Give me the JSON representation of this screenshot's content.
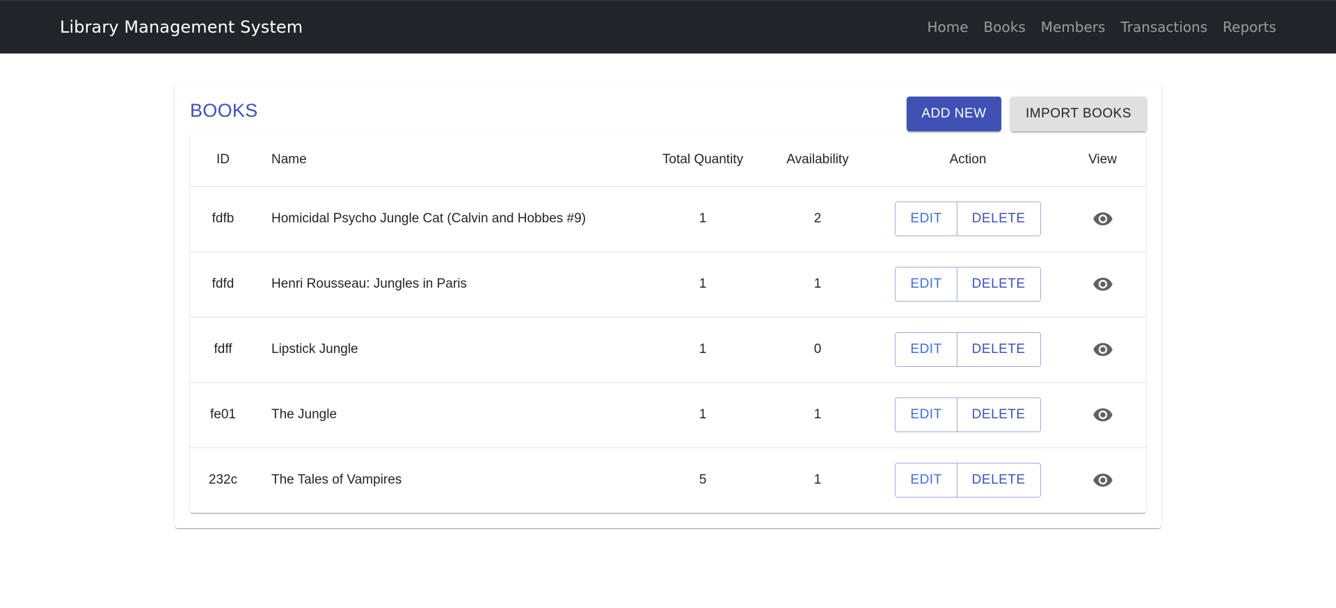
{
  "navbar": {
    "brand": "Library Management System",
    "links": [
      "Home",
      "Books",
      "Members",
      "Transactions",
      "Reports"
    ]
  },
  "card": {
    "title": "BOOKS",
    "add_new_label": "ADD NEW",
    "import_label": "IMPORT BOOKS"
  },
  "table": {
    "headers": {
      "id": "ID",
      "name": "Name",
      "total_quantity": "Total Quantity",
      "availability": "Availability",
      "action": "Action",
      "view": "View"
    },
    "rows": [
      {
        "id": "fdfb",
        "name": "Homicidal Psycho Jungle Cat (Calvin and Hobbes #9)",
        "total_quantity": "1",
        "availability": "2"
      },
      {
        "id": "fdfd",
        "name": "Henri Rousseau: Jungles in Paris",
        "total_quantity": "1",
        "availability": "1"
      },
      {
        "id": "fdff",
        "name": "Lipstick Jungle",
        "total_quantity": "1",
        "availability": "0"
      },
      {
        "id": "fe01",
        "name": "The Jungle",
        "total_quantity": "1",
        "availability": "1"
      },
      {
        "id": "232c",
        "name": "The Tales of Vampires",
        "total_quantity": "5",
        "availability": "1"
      }
    ],
    "edit_label": "EDIT",
    "delete_label": "DELETE",
    "view_icon": "eye-icon"
  },
  "colors": {
    "navbar_bg": "#212529",
    "primary": "#3f51b5",
    "secondary_button_bg": "#e0e0e0"
  }
}
